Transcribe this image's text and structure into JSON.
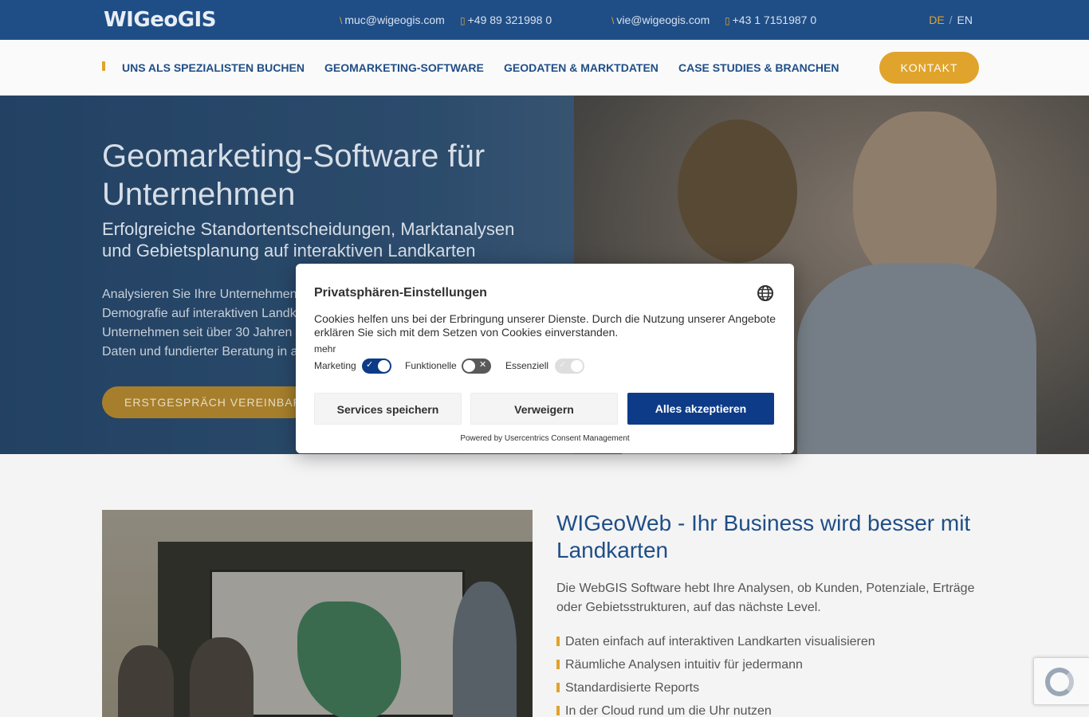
{
  "topbar": {
    "logo": "WIGeoGIS",
    "contacts": [
      {
        "icon": "email-icon",
        "text": "muc@wigeogis.com"
      },
      {
        "icon": "phone-icon",
        "text": "+49 89 321998 0"
      },
      {
        "icon": "email-icon",
        "text": "vie@wigeogis.com"
      },
      {
        "icon": "phone-icon",
        "text": "+43 1 7151987 0"
      }
    ],
    "languages": {
      "active": "DE",
      "other": "EN",
      "separator": "/"
    }
  },
  "nav": {
    "items": [
      "UNS ALS SPEZIALISTEN BUCHEN",
      "GEOMARKETING-SOFTWARE",
      "GEODATEN & MARKTDATEN",
      "CASE STUDIES & BRANCHEN"
    ],
    "contact_button": "KONTAKT"
  },
  "hero": {
    "title": "Geomarketing-Software für Unternehmen",
    "subtitle": "Erfolgreiche Standortentscheidungen, Marktanalysen und Gebietsplanung auf interaktiven Landkarten",
    "body_lines": [
      "Analysieren Sie Ihre Unternehmen",
      "Demografie auf interaktiven Landk",
      "Unternehmen seit über 30 Jahren",
      "Daten und fundierter Beratung in a"
    ],
    "cta": "ERSTGESPRÄCH VEREINBARE"
  },
  "content": {
    "title": "WIGeoWeb - Ihr Business wird besser mit Landkarten",
    "text": "Die WebGIS Software hebt Ihre Analysen, ob Kunden, Potenziale, Erträge oder Gebietsstrukturen, auf das nächste Level.",
    "bullets": [
      "Daten einfach auf interaktiven Landkarten visualisieren",
      "Räumliche Analysen intuitiv für jedermann",
      "Standardisierte Reports",
      "In der Cloud rund um die Uhr nutzen"
    ]
  },
  "consent": {
    "title": "Privatsphären-Einstellungen",
    "text": "Cookies helfen uns bei der Erbringung unserer Dienste. Durch die Nutzung unserer Angebote erklären Sie sich mit dem Setzen von Cookies einverstanden.",
    "more": "mehr",
    "toggles": [
      {
        "label": "Marketing",
        "state": "on"
      },
      {
        "label": "Funktionelle",
        "state": "off"
      },
      {
        "label": "Essenziell",
        "state": "locked"
      }
    ],
    "buttons": {
      "save": "Services speichern",
      "deny": "Verweigern",
      "accept": "Alles akzeptieren"
    },
    "powered": "Powered by Usercentrics Consent Management"
  },
  "colors": {
    "brand_blue": "#1f4e87",
    "accent_gold": "#e0a32b",
    "accept_blue": "#0e3b87"
  }
}
